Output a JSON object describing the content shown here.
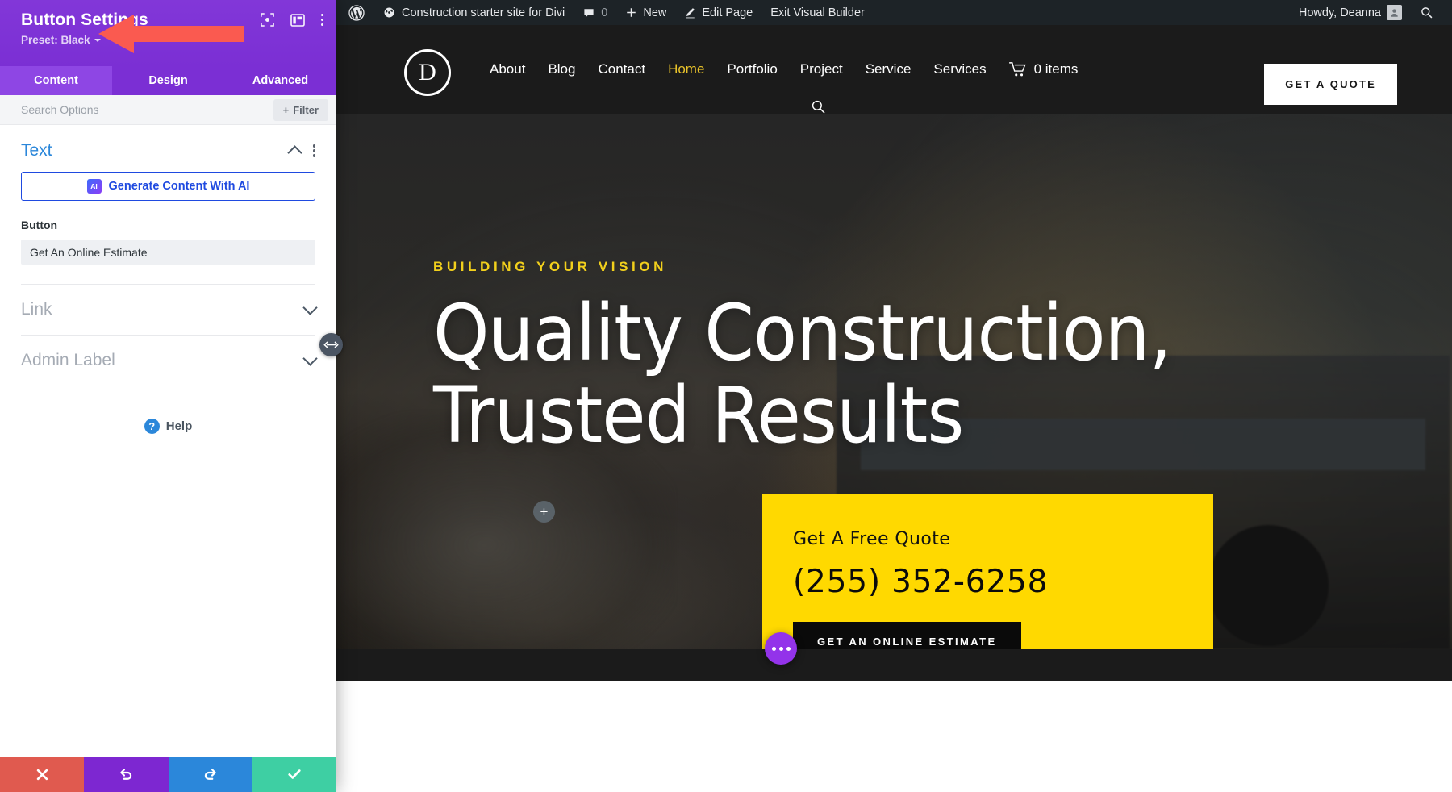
{
  "settings_panel": {
    "title": "Button Settings",
    "preset_label": "Preset: Black",
    "header_icons": [
      {
        "name": "focus-icon"
      },
      {
        "name": "layout-toggle-icon"
      },
      {
        "name": "kebab-menu-icon"
      }
    ],
    "tabs": [
      {
        "id": "content",
        "label": "Content",
        "active": true
      },
      {
        "id": "design",
        "label": "Design",
        "active": false
      },
      {
        "id": "advanced",
        "label": "Advanced",
        "active": false
      }
    ],
    "search": {
      "placeholder": "Search Options",
      "value": ""
    },
    "filter_label": "Filter",
    "sections": {
      "text": {
        "title": "Text",
        "ai_button_label": "Generate Content With AI",
        "ai_badge": "AI",
        "field_label": "Button",
        "field_value": "Get An Online Estimate"
      },
      "link": {
        "title": "Link"
      },
      "admin_label": {
        "title": "Admin Label"
      }
    },
    "help_label": "Help",
    "footer_buttons": [
      {
        "name": "cancel-button",
        "icon": "close-icon",
        "color": "#e05a4f"
      },
      {
        "name": "undo-button",
        "icon": "undo-icon",
        "color": "#7d27d1"
      },
      {
        "name": "redo-button",
        "icon": "redo-icon",
        "color": "#2b87da"
      },
      {
        "name": "save-button",
        "icon": "check-icon",
        "color": "#3ecfa3"
      }
    ]
  },
  "admin_bar": {
    "wp_logo": "wordpress-icon",
    "site_name": "Construction starter site for Divi",
    "comment_count": "0",
    "new_label": "New",
    "edit_page_label": "Edit Page",
    "exit_builder_label": "Exit Visual Builder",
    "howdy": "Howdy, Deanna",
    "search_icon": "search-icon"
  },
  "site": {
    "logo_letter": "D",
    "nav": [
      {
        "label": "About",
        "active": false
      },
      {
        "label": "Blog",
        "active": false
      },
      {
        "label": "Contact",
        "active": false
      },
      {
        "label": "Home",
        "active": true
      },
      {
        "label": "Portfolio",
        "active": false
      },
      {
        "label": "Project",
        "active": false
      },
      {
        "label": "Service",
        "active": false
      },
      {
        "label": "Services",
        "active": false
      }
    ],
    "cart_label": "0 items",
    "quote_button": "GET A QUOTE",
    "hero": {
      "eyebrow": "BUILDING YOUR VISION",
      "title_line1": "Quality Construction,",
      "title_line2": "Trusted Results"
    },
    "quote_card": {
      "label": "Get A Free Quote",
      "phone": "(255) 352-6258",
      "button": "GET AN ONLINE ESTIMATE"
    }
  },
  "colors": {
    "divi_purple": "#7b2fd4",
    "accent_yellow": "#ffd900",
    "nav_active": "#e8c22a",
    "ai_blue": "#1f4ae0",
    "section_blue": "#2b87da",
    "annotation_red": "#fa5a50"
  }
}
